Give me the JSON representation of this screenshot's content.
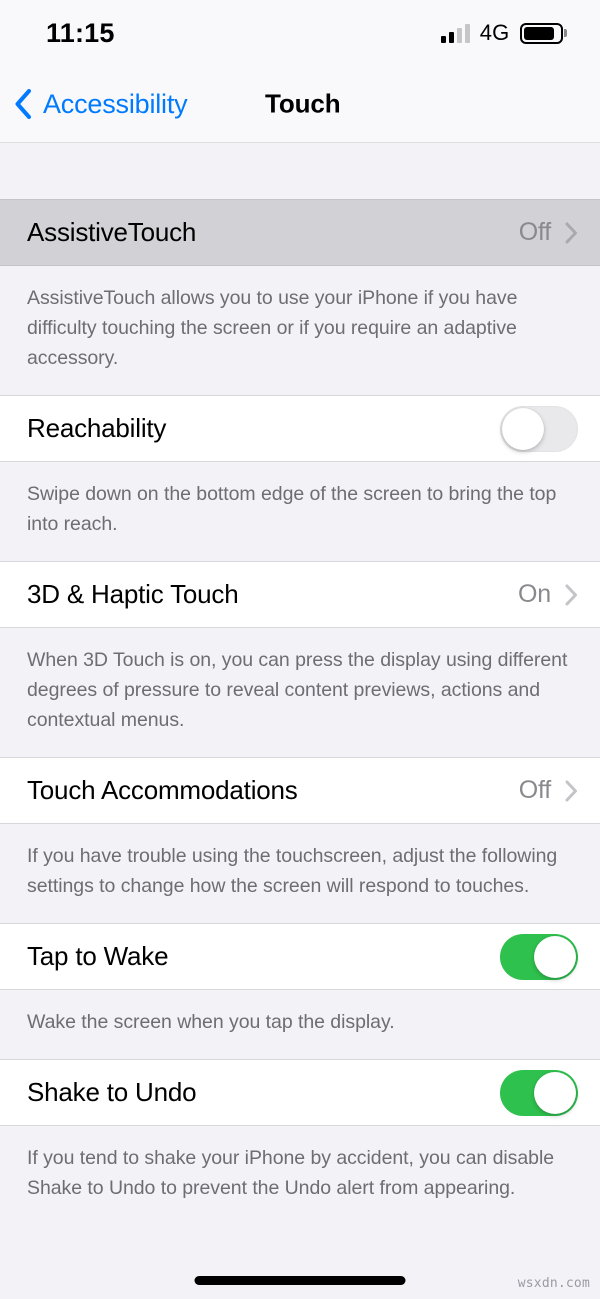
{
  "status_bar": {
    "time": "11:15",
    "network_label": "4G",
    "signal_bars_total": 4,
    "signal_bars_active": 2,
    "battery_level_percent": 88
  },
  "nav": {
    "back_label": "Accessibility",
    "title": "Touch",
    "accent_color": "#007AFF"
  },
  "colors": {
    "accent": "#007AFF",
    "toggle_on": "#2FC14E",
    "toggle_off": "#E9E9EB",
    "row_pressed": "#D1D1D6",
    "group_background": "#F2F2F7",
    "footer_text": "#6D6D72",
    "value_text": "#8A8A8E"
  },
  "sections": [
    {
      "row": {
        "label": "AssistiveTouch",
        "value": "Off",
        "type": "disclosure",
        "pressed": true
      },
      "footer": "AssistiveTouch allows you to use your iPhone if you have difficulty touching the screen or if you require an adaptive accessory."
    },
    {
      "row": {
        "label": "Reachability",
        "type": "switch",
        "switch_state": "off"
      },
      "footer": "Swipe down on the bottom edge of the screen to bring the top into reach."
    },
    {
      "row": {
        "label": "3D & Haptic Touch",
        "value": "On",
        "type": "disclosure",
        "pressed": false
      },
      "footer": "When 3D Touch is on, you can press the display using different degrees of pressure to reveal content previews, actions and contextual menus."
    },
    {
      "row": {
        "label": "Touch Accommodations",
        "value": "Off",
        "type": "disclosure",
        "pressed": false
      },
      "footer": "If you have trouble using the touchscreen, adjust the following settings to change how the screen will respond to touches."
    },
    {
      "row": {
        "label": "Tap to Wake",
        "type": "switch",
        "switch_state": "on"
      },
      "footer": "Wake the screen when you tap the display."
    },
    {
      "row": {
        "label": "Shake to Undo",
        "type": "switch",
        "switch_state": "on"
      },
      "footer": "If you tend to shake your iPhone by accident, you can disable Shake to Undo to prevent the Undo alert from appearing."
    }
  ],
  "watermark": "wsxdn.com"
}
